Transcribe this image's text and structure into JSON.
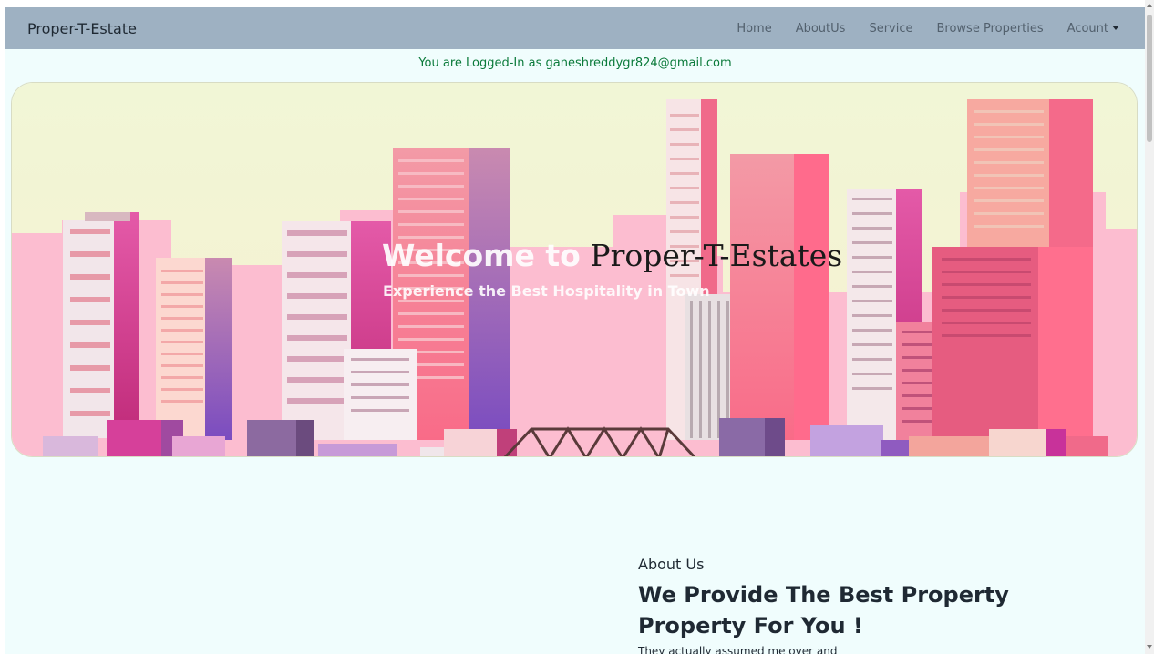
{
  "navbar": {
    "brand": "Proper-T-Estate",
    "links": [
      {
        "label": "Home"
      },
      {
        "label": "AboutUs"
      },
      {
        "label": "Service"
      },
      {
        "label": "Browse Properties"
      },
      {
        "label": "Acount"
      }
    ]
  },
  "status": {
    "logged_in_text": "You are Logged-In as ganeshreddygr824@gmail.com"
  },
  "hero": {
    "title_lead": "Welcome to",
    "title_brand": "Proper-T-Estates",
    "subtitle": "Experience the Best Hospitality in Town"
  },
  "about": {
    "kicker": "About Us",
    "heading": "We Provide The Best Property Property For You !",
    "text": "They actually assumed me over and"
  },
  "colors": {
    "navbar_bg": "#9eb1c2",
    "page_bg": "#f0fdfd",
    "status_green": "#0a7a3a"
  }
}
